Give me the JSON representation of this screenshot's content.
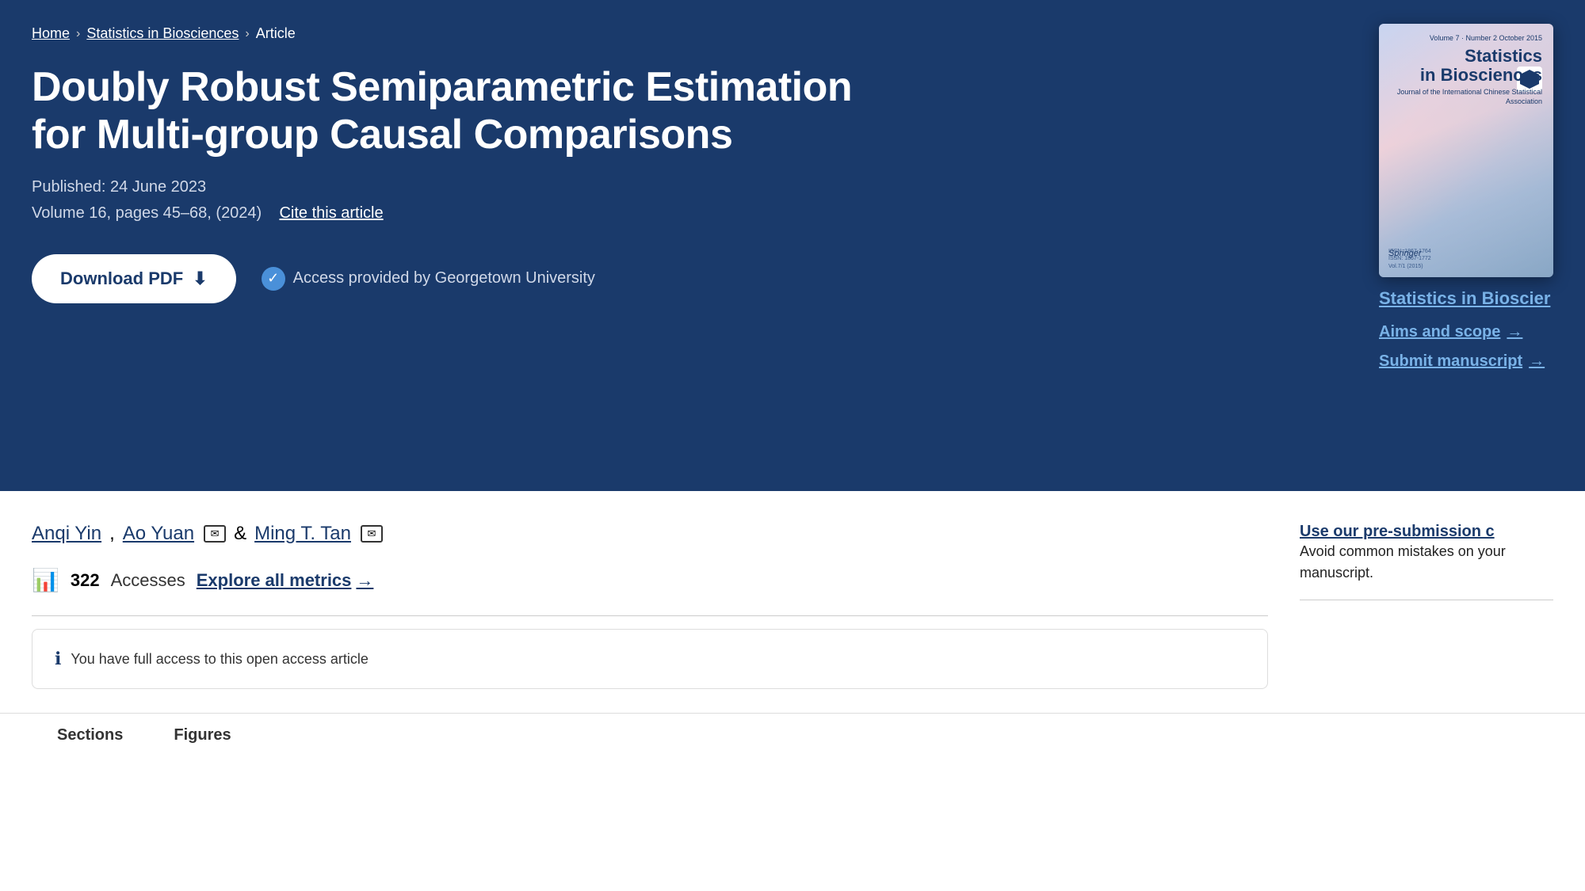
{
  "breadcrumb": {
    "home": "Home",
    "journal": "Statistics in Biosciences",
    "current": "Article"
  },
  "article": {
    "title": "Doubly Robust Semiparametric Estimation for Multi-group Causal Comparisons",
    "published": "Published: 24 June 2023",
    "volume": "Volume 16, pages 45–68, (2024)",
    "cite_label": "Cite this article"
  },
  "actions": {
    "download_pdf": "Download PDF",
    "access_text": "Access provided by Georgetown University"
  },
  "authors": {
    "list": "Anqi Yin, Ao Yuan",
    "ampersand": "&",
    "author3": "Ming T. Tan"
  },
  "metrics": {
    "count": "322",
    "label": "Accesses",
    "explore_label": "Explore all metrics",
    "explore_arrow": "→"
  },
  "journal": {
    "name": "Statistics in Bioscier",
    "aims_label": "Aims and scope",
    "aims_arrow": "→",
    "submit_label": "Submit manuscript",
    "submit_arrow": "→",
    "cover": {
      "vol_info": "Volume 7 · Number 2\nOctober 2015",
      "title_line1": "Statistics",
      "title_line2": "in Biosciences",
      "subtitle": "Journal of the\nInternational Chinese\nStatistical Association",
      "publisher": "Springer",
      "issn1": "ISSN: 1867-1764",
      "issn2": "ISSN: 1867-1772",
      "issn3": "Vol.7/1 (2015)"
    }
  },
  "sidebar": {
    "pre_submission_title": "Use our pre-submission c",
    "pre_submission_desc": "Avoid common mistakes on your manuscript."
  },
  "tabs": {
    "sections_label": "Sections",
    "figures_label": "Figures"
  }
}
